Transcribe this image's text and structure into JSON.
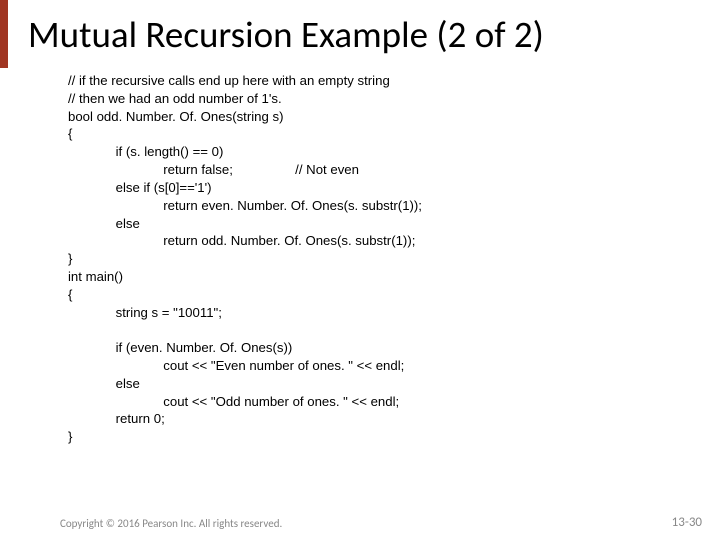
{
  "title": "Mutual Recursion Example (2 of 2)",
  "code": "// if the recursive calls end up here with an empty string\n// then we had an odd number of 1's.\nbool odd. Number. Of. Ones(string s)\n{\n             if (s. length() == 0)\n                          return false;                 // Not even\n             else if (s[0]=='1')\n                          return even. Number. Of. Ones(s. substr(1));\n             else\n                          return odd. Number. Of. Ones(s. substr(1));\n}\nint main()\n{\n             string s = \"10011\";\n\n             if (even. Number. Of. Ones(s))\n                          cout << \"Even number of ones. \" << endl;\n             else\n                          cout << \"Odd number of ones. \" << endl;\n             return 0;\n}",
  "copyright": "Copyright © 2016 Pearson Inc. All rights reserved.",
  "page_number": "13-30"
}
